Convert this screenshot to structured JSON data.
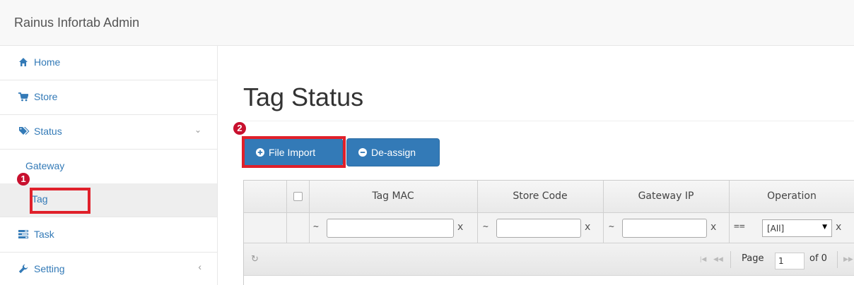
{
  "header": {
    "brand": "Rainus Infortab Admin"
  },
  "sidebar": {
    "items": [
      {
        "label": "Home"
      },
      {
        "label": "Store"
      },
      {
        "label": "Status",
        "chevron": "⌄"
      },
      {
        "label": "Gateway"
      },
      {
        "label": "Tag"
      },
      {
        "label": "Task"
      },
      {
        "label": "Setting",
        "chevron": "‹"
      }
    ]
  },
  "main": {
    "title": "Tag Status",
    "buttons": {
      "file_import": "File Import",
      "deassign": "De-assign"
    }
  },
  "annotations": {
    "step1": "1",
    "step2": "2"
  },
  "grid": {
    "columns": [
      "Tag MAC",
      "Store Code",
      "Gateway IP",
      "Operation"
    ],
    "filter": {
      "op_like": "~",
      "op_eq": "==",
      "clear": "x",
      "operation_selected": "[All]"
    },
    "pager": {
      "page_label": "Page",
      "page_value": "1",
      "of_label": "of 0",
      "refresh_icon": "↻"
    }
  },
  "colors": {
    "accent": "#337ab7",
    "highlight": "#e0202a",
    "badge": "#c8102e"
  }
}
